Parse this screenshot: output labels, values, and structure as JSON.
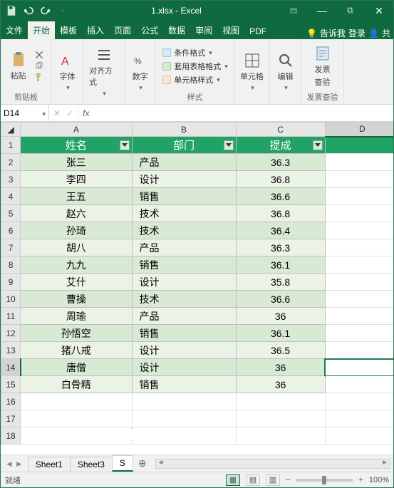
{
  "window": {
    "title": "1.xlsx - Excel"
  },
  "ribbon_tabs": {
    "file": "文件",
    "home": "开始",
    "template": "模板",
    "insert": "插入",
    "page": "页面",
    "formula": "公式",
    "data": "数据",
    "review": "审阅",
    "view": "视图",
    "pdf": "PDF",
    "tell_me": "告诉我",
    "signin": "登录",
    "share": "共"
  },
  "ribbon": {
    "clipboard": {
      "paste": "粘贴",
      "label": "剪贴板"
    },
    "font": {
      "btn": "字体",
      "label": ""
    },
    "align": {
      "btn": "对齐方式",
      "label": ""
    },
    "number": {
      "btn": "数字",
      "label": ""
    },
    "styles": {
      "cond": "条件格式",
      "table": "套用表格格式",
      "cell": "单元格样式",
      "label": "样式"
    },
    "cells": {
      "btn": "单元格",
      "label": ""
    },
    "editing": {
      "btn": "编辑",
      "label": ""
    },
    "invoice": {
      "btn": "发票\n查验",
      "btn_line1": "发票",
      "btn_line2": "查验",
      "label": "发票查验"
    }
  },
  "namebox": {
    "value": "D14"
  },
  "formula": {
    "value": ""
  },
  "headers": {
    "A": "A",
    "B": "B",
    "C": "C",
    "D": "D"
  },
  "tableHeaders": {
    "name": "姓名",
    "dept": "部门",
    "comm": "提成"
  },
  "rows": [
    {
      "name": "张三",
      "dept": "产品",
      "comm": "36.3"
    },
    {
      "name": "李四",
      "dept": "设计",
      "comm": "36.8"
    },
    {
      "name": "王五",
      "dept": "销售",
      "comm": "36.6"
    },
    {
      "name": "赵六",
      "dept": "技术",
      "comm": "36.8"
    },
    {
      "name": "孙琦",
      "dept": "技术",
      "comm": "36.4"
    },
    {
      "name": "胡八",
      "dept": "产品",
      "comm": "36.3"
    },
    {
      "name": "九九",
      "dept": "销售",
      "comm": "36.1"
    },
    {
      "name": "艾什",
      "dept": "设计",
      "comm": "35.8"
    },
    {
      "name": "曹操",
      "dept": "技术",
      "comm": "36.6"
    },
    {
      "name": "周瑜",
      "dept": "产品",
      "comm": "36"
    },
    {
      "name": "孙悟空",
      "dept": "销售",
      "comm": "36.1"
    },
    {
      "name": "猪八戒",
      "dept": "设计",
      "comm": "36.5"
    },
    {
      "name": "唐僧",
      "dept": "设计",
      "comm": "36"
    },
    {
      "name": "白骨精",
      "dept": "销售",
      "comm": "36"
    }
  ],
  "sheets": {
    "s1": "Sheet1",
    "s3": "Sheet3",
    "active": "S"
  },
  "status": {
    "ready": "就绪",
    "zoom": "100%"
  },
  "chart_data": {
    "type": "table",
    "columns": [
      "姓名",
      "部门",
      "提成"
    ],
    "data": [
      [
        "张三",
        "产品",
        36.3
      ],
      [
        "李四",
        "设计",
        36.8
      ],
      [
        "王五",
        "销售",
        36.6
      ],
      [
        "赵六",
        "技术",
        36.8
      ],
      [
        "孙琦",
        "技术",
        36.4
      ],
      [
        "胡八",
        "产品",
        36.3
      ],
      [
        "九九",
        "销售",
        36.1
      ],
      [
        "艾什",
        "设计",
        35.8
      ],
      [
        "曹操",
        "技术",
        36.6
      ],
      [
        "周瑜",
        "产品",
        36
      ],
      [
        "孙悟空",
        "销售",
        36.1
      ],
      [
        "猪八戒",
        "设计",
        36.5
      ],
      [
        "唐僧",
        "设计",
        36
      ],
      [
        "白骨精",
        "销售",
        36
      ]
    ]
  }
}
